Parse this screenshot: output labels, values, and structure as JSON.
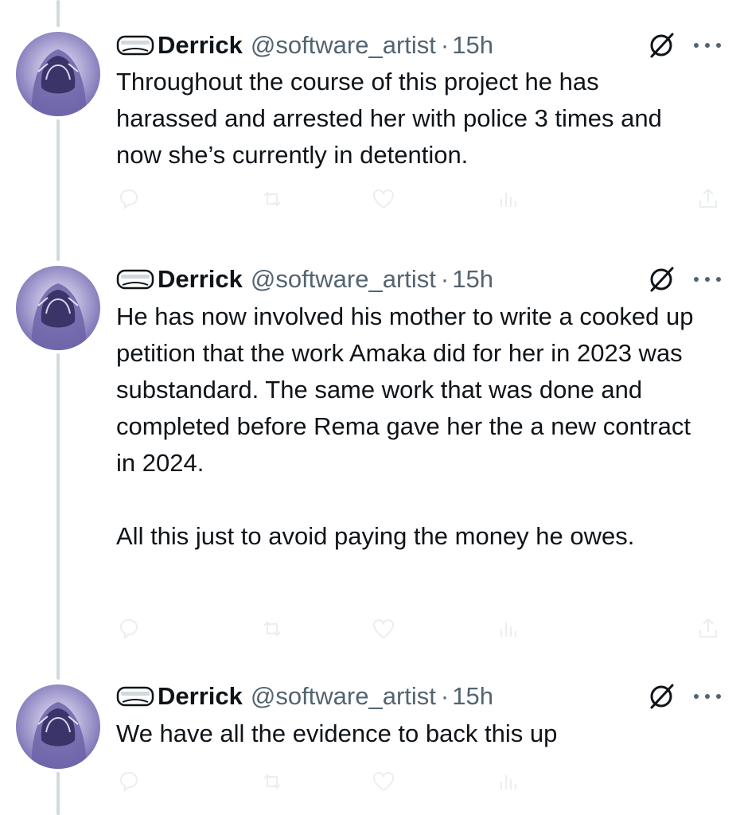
{
  "tweets": [
    {
      "name": "Derrick",
      "handle": "@software_artist",
      "separator": "·",
      "time": "15h",
      "text": "Throughout the course of this project he has harassed and arrested her with police 3 times and now she’s currently in detention."
    },
    {
      "name": "Derrick",
      "handle": "@software_artist",
      "separator": "·",
      "time": "15h",
      "text": "He has now involved his mother to write a cooked up petition that the work Amaka did for her in 2023 was substandard. The same work that was done and completed before Rema gave her the a new contract in 2024.\n\nAll this just to avoid paying the money he owes."
    },
    {
      "name": "Derrick",
      "handle": "@software_artist",
      "separator": "·",
      "time": "15h",
      "text": "We have all the evidence to back this up"
    }
  ],
  "icons": {
    "verified_badge": "goggles-icon",
    "grok": "grok-icon",
    "more": "more-icon",
    "reply": "reply-icon",
    "repost": "repost-icon",
    "like": "like-icon",
    "views": "views-icon",
    "share": "share-icon"
  },
  "colors": {
    "text": "#0f1419",
    "secondary": "#536471",
    "thread_line": "#cfd9de",
    "faded_actions": "#ebeef0"
  }
}
